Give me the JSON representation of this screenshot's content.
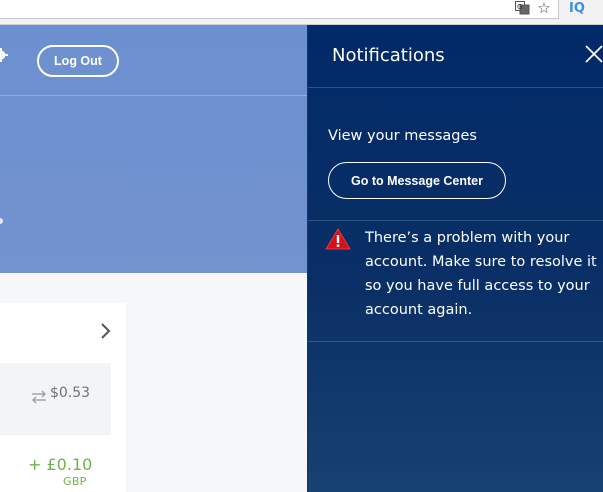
{
  "header": {
    "logout_label": "Log Out"
  },
  "browser": {
    "extension_label": "IQ"
  },
  "account_card": {
    "pending_amount": "$0.53",
    "balance_amount": "+ £0.10",
    "balance_currency": "GBP"
  },
  "notifications": {
    "title": "Notifications",
    "messages_label": "View your messages",
    "message_center_button": "Go to Message Center",
    "alert_text": "There’s a problem with your account. Make sure to resolve it so you have full access to your account again."
  },
  "colors": {
    "panel_bg": "#012a68",
    "hero_bg": "#6c8fcf",
    "positive_green": "#6fb34a",
    "warning_red": "#d0121b"
  },
  "icons": [
    "translate-icon",
    "star-icon",
    "gear-icon",
    "chevron-right-icon",
    "transfer-icon",
    "close-icon",
    "warning-icon"
  ]
}
